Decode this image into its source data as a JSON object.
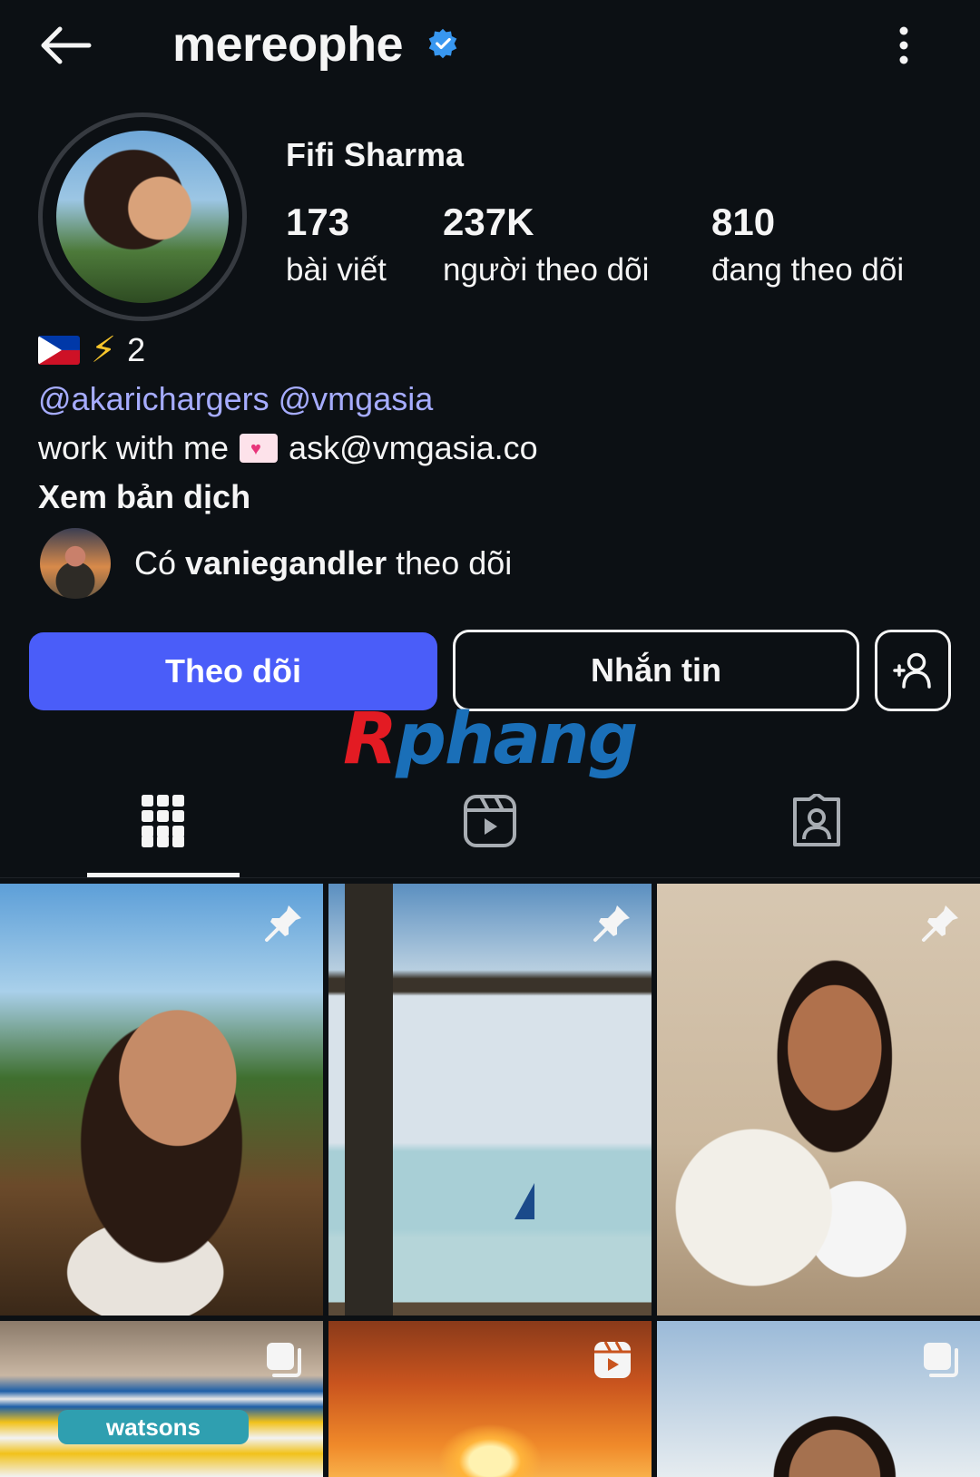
{
  "header": {
    "username": "mereophe",
    "verified": true,
    "icons": {
      "back": "arrow-left-icon",
      "more": "more-vertical-icon",
      "verified": "verified-badge-icon"
    }
  },
  "profile": {
    "display_name": "Fifi Sharma",
    "stats": [
      {
        "value": "173",
        "label": "bài viết"
      },
      {
        "value": "237K",
        "label": "người theo dõi"
      },
      {
        "value": "810",
        "label": "đang theo dõi"
      }
    ]
  },
  "bio": {
    "line1_suffix": "2",
    "line1_icons": [
      "philippines-flag-icon",
      "lightning-bolt-icon"
    ],
    "mentions": "@akarichargers @vmgasia",
    "work_prefix": "work with me",
    "work_icon": "love-letter-icon",
    "work_email": "ask@vmgasia.co",
    "see_translation": "Xem bản dịch"
  },
  "mutual": {
    "prefix": "Có",
    "name": "vaniegandler",
    "suffix": "theo dõi"
  },
  "actions": {
    "follow_label": "Theo dõi",
    "message_label": "Nhắn tin",
    "add_user_icon": "add-user-icon"
  },
  "watermark": {
    "text_first": "R",
    "text_rest": "phang"
  },
  "tabs": [
    {
      "icon": "grid-icon",
      "selected": true
    },
    {
      "icon": "reels-icon",
      "selected": false
    },
    {
      "icon": "tagged-icon",
      "selected": false
    }
  ],
  "posts": [
    {
      "overlay": "pin-icon"
    },
    {
      "overlay": "pin-icon"
    },
    {
      "overlay": "pin-icon"
    },
    {
      "overlay": "carousel-icon",
      "sign_text": "watsons"
    },
    {
      "overlay": "reels-icon"
    },
    {
      "overlay": "carousel-icon"
    }
  ],
  "colors": {
    "background": "#0c1014",
    "primary_button": "#4a5df9",
    "mention": "#a6acff",
    "verified": "#3897f0"
  }
}
